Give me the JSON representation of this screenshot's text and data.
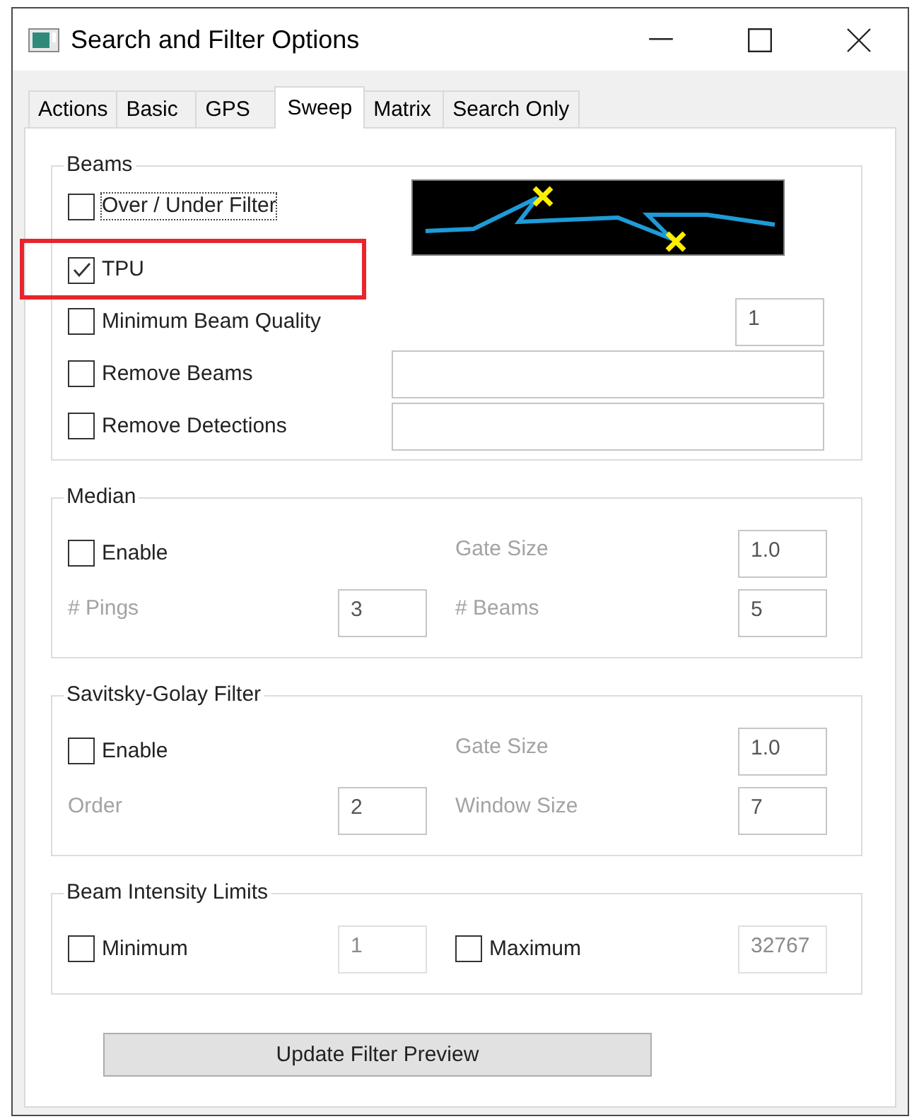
{
  "window": {
    "title": "Search and Filter Options"
  },
  "tabs": [
    {
      "label": "Actions",
      "selected": false
    },
    {
      "label": "Basic",
      "selected": false
    },
    {
      "label": "GPS",
      "selected": false
    },
    {
      "label": "Sweep",
      "selected": true
    },
    {
      "label": "Matrix",
      "selected": false
    },
    {
      "label": "Search Only",
      "selected": false
    }
  ],
  "beams": {
    "title": "Beams",
    "options": [
      {
        "kind": "plain",
        "label": "Over / Under Filter",
        "checked": false,
        "focused": true,
        "highlighted": false
      },
      {
        "kind": "plain",
        "label": "TPU",
        "checked": true,
        "focused": false,
        "highlighted": true
      },
      {
        "kind": "number",
        "label": "Minimum Beam Quality",
        "checked": false,
        "focused": false,
        "highlighted": false,
        "field": {
          "value": "1",
          "disabled": false
        }
      },
      {
        "kind": "text",
        "label": "Remove Beams",
        "checked": false,
        "focused": false,
        "highlighted": false,
        "field": {
          "disabled": false
        }
      },
      {
        "kind": "text",
        "label": "Remove Detections",
        "checked": false,
        "focused": false,
        "highlighted": false,
        "field": {
          "disabled": false
        }
      }
    ]
  },
  "groups": [
    {
      "title": "Median",
      "cells": [
        {
          "kind": "checkbox",
          "label": "Enable",
          "checked": false
        },
        {
          "kind": "param",
          "label": "Gate Size",
          "disabled": true,
          "value": "1.0"
        },
        {
          "kind": "param",
          "label": "# Pings",
          "disabled": true,
          "value": "3"
        },
        {
          "kind": "param",
          "label": "# Beams",
          "disabled": true,
          "value": "5"
        }
      ]
    },
    {
      "title": "Savitsky-Golay Filter",
      "cells": [
        {
          "kind": "checkbox",
          "label": "Enable",
          "checked": false
        },
        {
          "kind": "param",
          "label": "Gate Size",
          "disabled": true,
          "value": "1.0"
        },
        {
          "kind": "param",
          "label": "Order",
          "disabled": true,
          "value": "2"
        },
        {
          "kind": "param",
          "label": "Window Size",
          "disabled": true,
          "value": "7"
        }
      ]
    },
    {
      "title": "Beam Intensity Limits",
      "cells": [
        {
          "kind": "checkbox-param",
          "label": "Minimum",
          "checked": false,
          "value": "1",
          "disabled": true
        },
        {
          "kind": "checkbox-param",
          "label": "Maximum",
          "checked": false,
          "value": "32767",
          "disabled": true
        }
      ]
    }
  ],
  "button": {
    "label": "Update Filter Preview"
  }
}
